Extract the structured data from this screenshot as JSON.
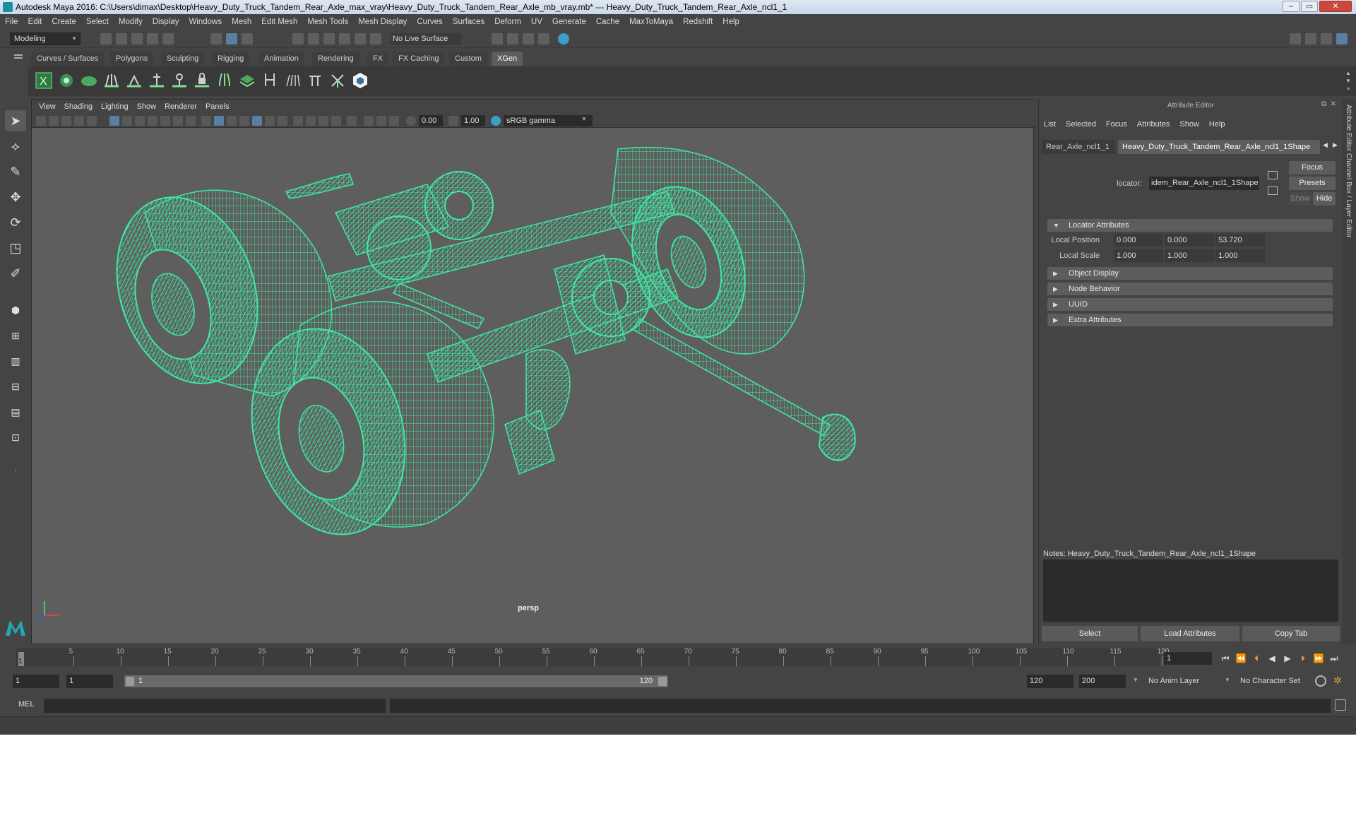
{
  "window": {
    "title": "Autodesk Maya 2016: C:\\Users\\dimax\\Desktop\\Heavy_Duty_Truck_Tandem_Rear_Axle_max_vray\\Heavy_Duty_Truck_Tandem_Rear_Axle_mb_vray.mb*   ---   Heavy_Duty_Truck_Tandem_Rear_Axle_ncl1_1",
    "minimize": "–",
    "maximize": "▭",
    "close": "✕"
  },
  "menu": [
    "File",
    "Edit",
    "Create",
    "Select",
    "Modify",
    "Display",
    "Windows",
    "Mesh",
    "Edit Mesh",
    "Mesh Tools",
    "Mesh Display",
    "Curves",
    "Surfaces",
    "Deform",
    "UV",
    "Generate",
    "Cache",
    "MaxToMaya",
    "Redshift",
    "Help"
  ],
  "status": {
    "mode": "Modeling",
    "live_surface": "No Live Surface"
  },
  "shelf_tabs": [
    "Curves / Surfaces",
    "Polygons",
    "Sculpting",
    "Rigging",
    "Animation",
    "Rendering",
    "FX",
    "FX Caching",
    "Custom",
    "XGen"
  ],
  "active_shelf": "XGen",
  "viewport": {
    "menu": [
      "View",
      "Shading",
      "Lighting",
      "Show",
      "Renderer",
      "Panels"
    ],
    "exposure": "0.00",
    "gamma": "1.00",
    "color_space": "sRGB gamma",
    "camera": "persp",
    "wire_color": "#3ee8a2"
  },
  "attribute_editor": {
    "title": "Attribute Editor",
    "menu": [
      "List",
      "Selected",
      "Focus",
      "Attributes",
      "Show",
      "Help"
    ],
    "tabs": [
      "Rear_Axle_ncl1_1",
      "Heavy_Duty_Truck_Tandem_Rear_Axle_ncl1_1Shape"
    ],
    "locator_label": "locator:",
    "locator_value": "idem_Rear_Axle_ncl1_1Shape",
    "buttons": {
      "focus": "Focus",
      "presets": "Presets",
      "show": "Show",
      "hide": "Hide"
    },
    "sections": {
      "locator": "Locator Attributes",
      "object_display": "Object Display",
      "node_behavior": "Node Behavior",
      "uuid": "UUID",
      "extra": "Extra Attributes"
    },
    "local_position": {
      "label": "Local Position",
      "x": "0.000",
      "y": "0.000",
      "z": "53.720"
    },
    "local_scale": {
      "label": "Local Scale",
      "x": "1.000",
      "y": "1.000",
      "z": "1.000"
    },
    "notes_label": "Notes:  Heavy_Duty_Truck_Tandem_Rear_Axle_ncl1_1Shape",
    "bottom_buttons": {
      "select": "Select",
      "load": "Load Attributes",
      "copy": "Copy Tab"
    }
  },
  "right_strip": "Attribute Editor   Channel Box / Layer Editor",
  "timeline": {
    "ticks": [
      "5",
      "10",
      "15",
      "20",
      "25",
      "30",
      "35",
      "40",
      "45",
      "50",
      "55",
      "60",
      "65",
      "70",
      "75",
      "80",
      "85",
      "90",
      "95",
      "100",
      "105",
      "110",
      "115",
      "120"
    ],
    "start_marker": "1",
    "current_frame": "1"
  },
  "range": {
    "start": "1",
    "playback_start": "1",
    "slider_start": "1",
    "slider_end": "120",
    "playback_end": "120",
    "end": "200",
    "anim_layer": "No Anim Layer",
    "character_set": "No Character Set"
  },
  "command": {
    "label": "MEL"
  }
}
